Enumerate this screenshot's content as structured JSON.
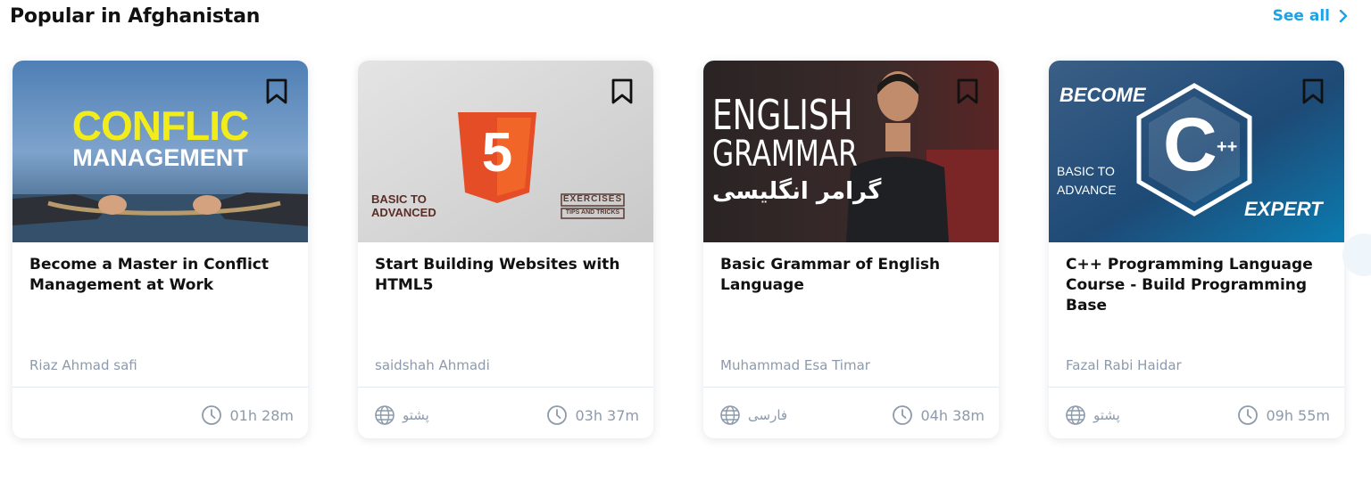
{
  "section": {
    "title": "Popular in Afghanistan",
    "see_all": "See all"
  },
  "cards": [
    {
      "title": "Become a Master in Conflict Management at Work",
      "author": "Riaz Ahmad safi",
      "language": "",
      "duration": "01h 28m",
      "thumb": {
        "line1": "CONFLIC",
        "line2": "MANAGEMENT"
      }
    },
    {
      "title": "Start Building Websites with HTML5",
      "author": "saidshah Ahmadi",
      "language": "پشتو",
      "duration": "03h 37m",
      "thumb": {
        "badge": "5",
        "left1": "BASIC TO",
        "left2": "ADVANCED",
        "right1": "EXERCISES",
        "right2": "TIPS AND TRICKS"
      }
    },
    {
      "title": "Basic Grammar of English Language",
      "author": "Muhammad Esa Timar",
      "language": "فارسی",
      "duration": "04h 38m",
      "thumb": {
        "line1": "ENGLISH",
        "line2": "GRAMMAR",
        "line3": "گرامر انگلیسی"
      }
    },
    {
      "title": "C++ Programming Language Course - Build Programming Base",
      "author": "Fazal Rabi Haidar",
      "language": "پشتو",
      "duration": "09h 55m",
      "thumb": {
        "top": "BECOME",
        "mid1": "BASIC TO",
        "mid2": "ADVANCE",
        "bottom": "EXPERT",
        "logo": "C",
        "plus": "++"
      }
    }
  ],
  "colors": {
    "accent": "#1aa3e8",
    "muted": "#8c9aab",
    "html5": "#e44d26"
  },
  "icons": {
    "bookmark": "bookmark-icon",
    "globe": "globe-icon",
    "clock": "clock-icon",
    "chevron": "chevron-right-icon"
  }
}
